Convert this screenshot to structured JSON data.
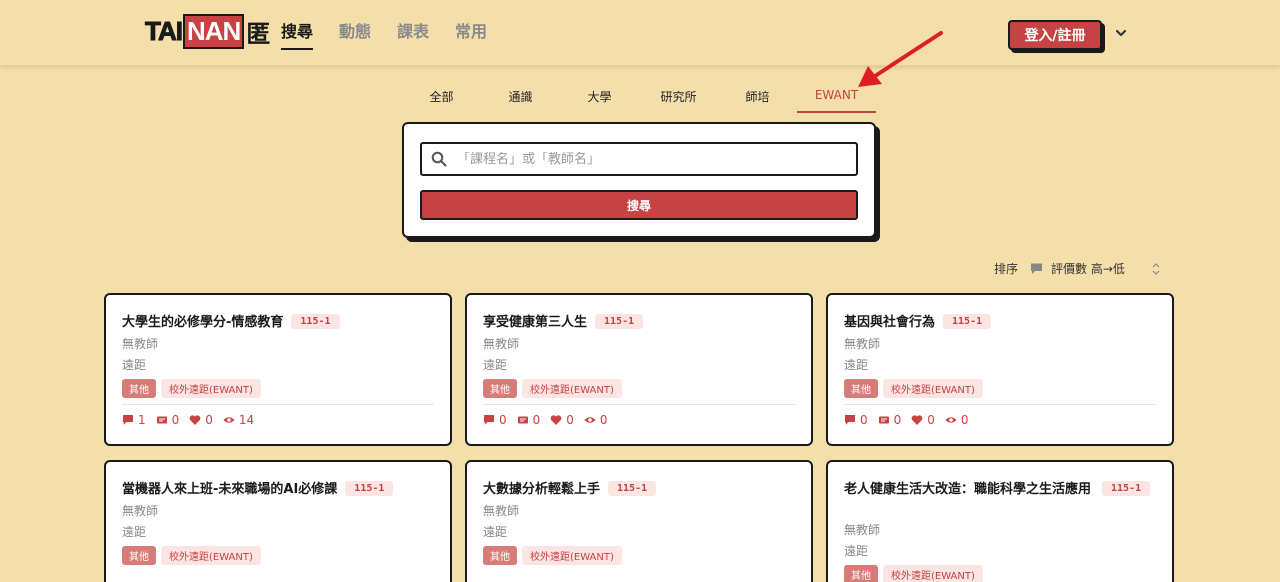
{
  "header": {
    "logo": {
      "part1": "TAI",
      "part2": "NAN",
      "part3": "匿"
    },
    "nav": [
      {
        "label": "搜尋",
        "active": true
      },
      {
        "label": "動態",
        "active": false
      },
      {
        "label": "課表",
        "active": false
      },
      {
        "label": "常用",
        "active": false
      }
    ],
    "login_label": "登入/註冊"
  },
  "tabs": [
    {
      "label": "全部",
      "active": false
    },
    {
      "label": "通識",
      "active": false
    },
    {
      "label": "大學",
      "active": false
    },
    {
      "label": "研究所",
      "active": false
    },
    {
      "label": "師培",
      "active": false
    },
    {
      "label": "EWANT",
      "active": true
    }
  ],
  "search": {
    "placeholder": "「課程名」或「教師名」",
    "button_label": "搜尋"
  },
  "sort": {
    "label": "排序",
    "value": "評價數 高→低"
  },
  "courses": [
    {
      "title": "大學生的必修學分-情感教育",
      "semester": "115-1",
      "teacher": "無教師",
      "mode": "遠距",
      "category": "其他",
      "source": "校外遠距(EWANT)",
      "comments": "1",
      "reviews": "0",
      "likes": "0",
      "views": "14"
    },
    {
      "title": "享受健康第三人生",
      "semester": "115-1",
      "teacher": "無教師",
      "mode": "遠距",
      "category": "其他",
      "source": "校外遠距(EWANT)",
      "comments": "0",
      "reviews": "0",
      "likes": "0",
      "views": "0"
    },
    {
      "title": "基因與社會行為",
      "semester": "115-1",
      "teacher": "無教師",
      "mode": "遠距",
      "category": "其他",
      "source": "校外遠距(EWANT)",
      "comments": "0",
      "reviews": "0",
      "likes": "0",
      "views": "0"
    },
    {
      "title": "當機器人來上班-未來職場的AI必修課",
      "semester": "115-1",
      "teacher": "無教師",
      "mode": "遠距",
      "category": "其他",
      "source": "校外遠距(EWANT)"
    },
    {
      "title": "大數據分析輕鬆上手",
      "semester": "115-1",
      "teacher": "無教師",
      "mode": "遠距",
      "category": "其他",
      "source": "校外遠距(EWANT)"
    },
    {
      "title": "老人健康生活大改造：職能科學之生活應用",
      "semester": "115-1",
      "teacher": "無教師",
      "mode": "遠距",
      "category": "其他",
      "source": "校外遠距(EWANT)"
    }
  ],
  "colors": {
    "accent": "#c74242",
    "background": "#f4dfab",
    "tag_light": "#fbe5e3"
  }
}
